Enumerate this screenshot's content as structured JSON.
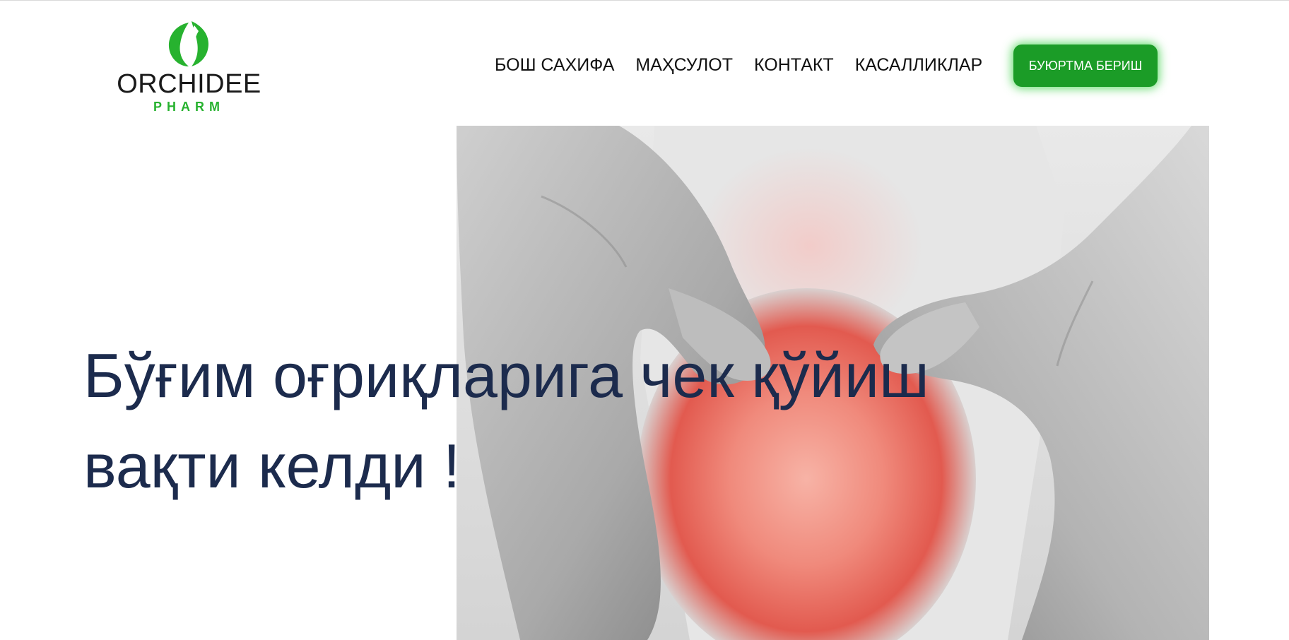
{
  "brand": {
    "name": "ORCHIDEE",
    "sub": "PHARM",
    "primary_color": "#27b22f",
    "text_color": "#1a1a1a",
    "logo_icon": "leaf-logo-icon"
  },
  "nav": {
    "items": [
      {
        "label": "БОШ САХИФА"
      },
      {
        "label": "МАҲСУЛОТ"
      },
      {
        "label": "КОНТАКТ"
      },
      {
        "label": "КАСАЛЛИКЛАР"
      }
    ],
    "cta_label": "БУЮРТМА БЕРИШ",
    "cta_color": "#1b9c27"
  },
  "hero": {
    "headline_line1": "Бўғим оғриқларига чек қўйиш",
    "headline_line2": "вақти келди !",
    "headline_color": "#1c2b4d",
    "image_subject": "hands-on-painful-knee-photo"
  }
}
